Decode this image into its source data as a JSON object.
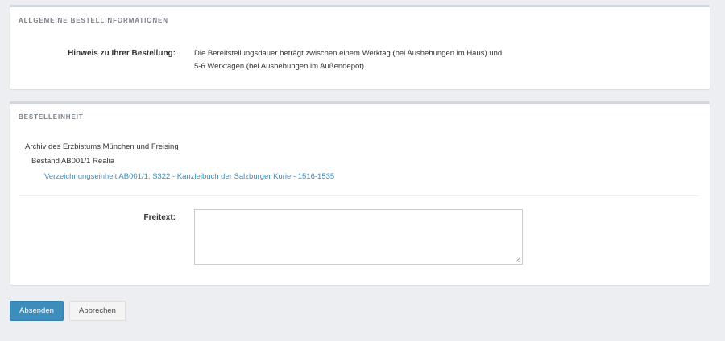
{
  "general": {
    "title": "ALLGEMEINE BESTELLINFORMATIONEN",
    "hint_label": "Hinweis zu Ihrer Bestellung:",
    "hint_line1": "Die Bereitstellungsdauer beträgt zwischen einem Werktag (bei Aushebungen im Haus) und",
    "hint_line2": "5-6 Werktagen (bei Aushebungen im Außendepot)."
  },
  "unit": {
    "title": "BESTELLEINHEIT",
    "archive": "Archiv des Erzbistums München und Freising",
    "holding": "Bestand AB001/1 Realia",
    "item_link": "Verzeichnungseinheit AB001/1, S322 - Kanzleibuch der Salzburger Kurie - 1516-1535",
    "freetext_label": "Freitext:",
    "freetext_value": ""
  },
  "actions": {
    "submit": "Absenden",
    "cancel": "Abbrechen"
  },
  "colors": {
    "primary": "#3c8dbc",
    "background": "#eceef1"
  }
}
